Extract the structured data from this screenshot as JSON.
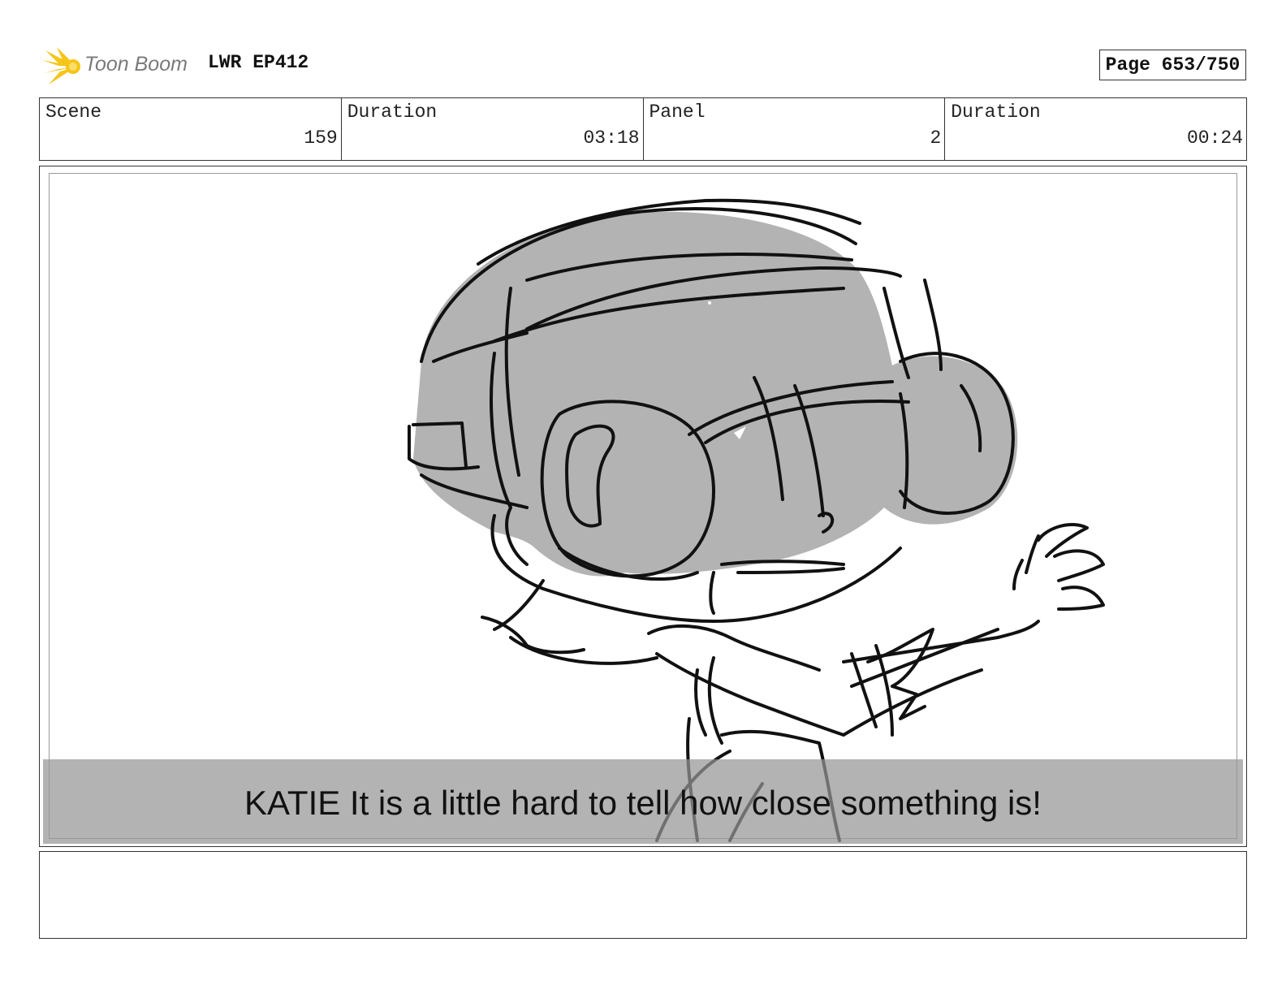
{
  "header": {
    "logo_text": "Toon Boom",
    "project": "LWR EP412",
    "page": "Page 653/750"
  },
  "info": {
    "scene_label": "Scene",
    "scene_value": "159",
    "scene_duration_label": "Duration",
    "scene_duration_value": "03:18",
    "panel_label": "Panel",
    "panel_value": "2",
    "panel_duration_label": "Duration",
    "panel_duration_value": "00:24"
  },
  "panel": {
    "dialog": "KATIE It is a little hard to tell how close something is!"
  },
  "notes": {
    "text": ""
  },
  "colors": {
    "logo_burst": "#f5c518",
    "shading": "#b3b3b3",
    "ink": "#111111"
  }
}
